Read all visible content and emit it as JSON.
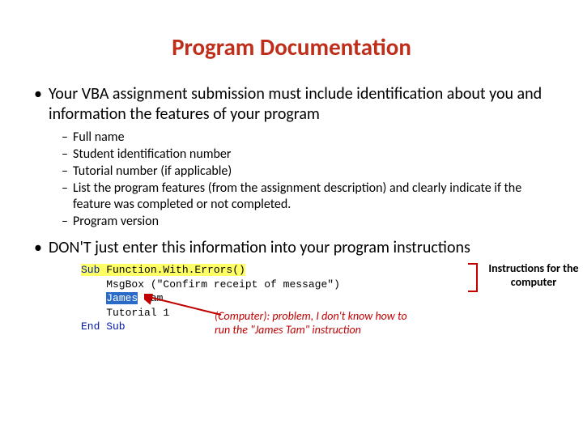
{
  "title": "Program Documentation",
  "bullets": {
    "b1": "Your VBA assignment submission must include identification about you and information the features of your program",
    "sub1": "Full name",
    "sub2": "Student identification number",
    "sub3": "Tutorial number (if applicable)",
    "sub4": "List the program features (from the assignment description) and clearly indicate if the feature was completed or not completed.",
    "sub5": "Program version",
    "b2": "DON'T just enter this information into your program instructions"
  },
  "code": {
    "kw_sub": "Sub",
    "line1_rest": " Function.With.Errors()",
    "line2_a": "    MsgBox (",
    "line2_str": "\"Confirm receipt of message\"",
    "line2_b": ")",
    "line3_hl": "James",
    "line3_rest": " Tam",
    "line4": "    Tutorial 1",
    "kw_end": "End Sub"
  },
  "annotations": {
    "instructions": "Instructions for the computer",
    "problem": "(Computer): problem, I don't know how to run the \"James Tam\" instruction"
  }
}
